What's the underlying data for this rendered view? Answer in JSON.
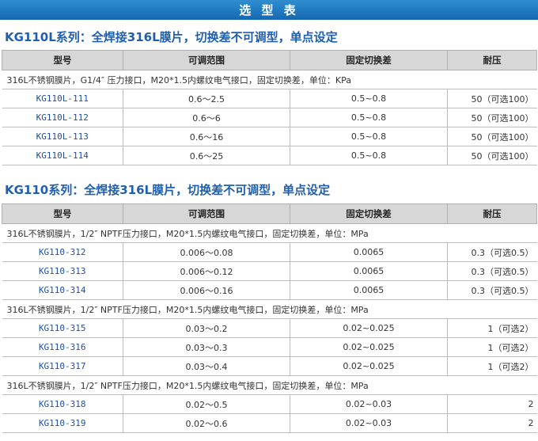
{
  "banner_title": "选 型 表",
  "headers": [
    "型号",
    "可调范围",
    "固定切换差",
    "耐压"
  ],
  "section1": {
    "title": "KG110L系列：全焊接316L膜片，切换差不可调型，单点设定",
    "desc": "316L不锈钢膜片，G1/4″ 压力接口，M20*1.5内螺纹电气接口，固定切换差，单位：KPa",
    "rows": [
      {
        "model": "KG110L-111",
        "range": "0.6～2.5",
        "diff": "0.5~0.8",
        "pressure": "50（可选100）"
      },
      {
        "model": "KG110L-112",
        "range": "0.6～6",
        "diff": "0.5~0.8",
        "pressure": "50（可选100）"
      },
      {
        "model": "KG110L-113",
        "range": "0.6～16",
        "diff": "0.5~0.8",
        "pressure": "50（可选100）"
      },
      {
        "model": "KG110L-114",
        "range": "0.6～25",
        "diff": "0.5~0.8",
        "pressure": "50（可选100）"
      }
    ]
  },
  "section2": {
    "title": "KG110系列：全焊接316L膜片，切换差不可调型，单点设定",
    "desc1": "316L不锈钢膜片，1/2″ NPTF压力接口，M20*1.5内螺纹电气接口，固定切换差，单位：MPa",
    "rows1": [
      {
        "model": "KG110-312",
        "range": "0.006～0.08",
        "diff": "0.0065",
        "pressure": "0.3（可选0.5）"
      },
      {
        "model": "KG110-313",
        "range": "0.006～0.12",
        "diff": "0.0065",
        "pressure": "0.3（可选0.5）"
      },
      {
        "model": "KG110-314",
        "range": "0.006～0.16",
        "diff": "0.0065",
        "pressure": "0.3（可选0.5）"
      }
    ],
    "desc2": "316L不锈钢膜片，1/2″ NPTF压力接口，M20*1.5内螺纹电气接口，固定切换差，单位：MPa",
    "rows2": [
      {
        "model": "KG110-315",
        "range": "0.03～0.2",
        "diff": "0.02~0.025",
        "pressure": "1（可选2）"
      },
      {
        "model": "KG110-316",
        "range": "0.03～0.3",
        "diff": "0.02~0.025",
        "pressure": "1（可选2）"
      },
      {
        "model": "KG110-317",
        "range": "0.03～0.4",
        "diff": "0.02~0.025",
        "pressure": "1（可选2）"
      }
    ],
    "desc3": "316L不锈钢膜片，1/2″ NPTF压力接口，M20*1.5内螺纹电气接口，固定切换差，单位：MPa",
    "rows3": [
      {
        "model": "KG110-318",
        "range": "0.02～0.5",
        "diff": "0.02~0.03",
        "pressure": "2"
      },
      {
        "model": "KG110-319",
        "range": "0.02～0.6",
        "diff": "0.02~0.03",
        "pressure": "2"
      }
    ]
  }
}
